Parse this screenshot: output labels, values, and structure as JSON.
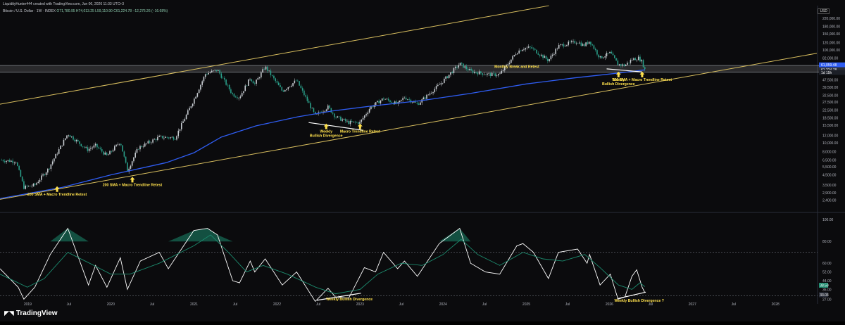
{
  "header": {
    "credit": "LiquidityHunter444 created with TradingView.com, Jun 06, 2026 11:33 UTC+3",
    "symbol": "Bitcoin / U.S. Dollar · 1W · INDEX",
    "ohlc": "O71,780.95 H74,013.25 L59,110.90 C61,224.78 −12,276.26 (−16.68%)"
  },
  "currency_badge": "USD",
  "brand": "TradingView",
  "colors": {
    "up_candle": "#c8cdd2",
    "down_candle": "#2aa08a",
    "sma": "#2f5df2",
    "trendline": "#d9bf5f",
    "annotation": "#ffe14d",
    "rsi": "#ffffff",
    "rsi_ma": "#1c8b6e",
    "background": "#0b0b0d"
  },
  "chart_data": [
    {
      "type": "candlestick",
      "title": "",
      "xlabel": "",
      "ylabel": "",
      "scale": "log",
      "ylim": [
        1900,
        290000
      ],
      "xlim": [
        "2018-09-01",
        "2028-07-01"
      ],
      "y_ticks": [
        "220,000.00",
        "180,000.00",
        "150,000.00",
        "120,000.00",
        "100,000.00",
        "82,000.00",
        "68,000.00",
        "57,500.00",
        "47,500.00",
        "39,500.00",
        "32,500.00",
        "27,500.00",
        "22,500.00",
        "18,500.00",
        "15,500.00",
        "12,000.00",
        "10,000.00",
        "8,000.00",
        "6,500.00",
        "5,500.00",
        "4,500.00",
        "3,500.00",
        "2,900.00",
        "2,400.00"
      ],
      "x_ticks": [
        {
          "date": "2019-01-01",
          "label": "2019"
        },
        {
          "date": "2019-07-01",
          "label": "Jul"
        },
        {
          "date": "2020-01-01",
          "label": "2020"
        },
        {
          "date": "2020-07-01",
          "label": "Jul"
        },
        {
          "date": "2021-01-01",
          "label": "2021"
        },
        {
          "date": "2021-07-01",
          "label": "Jul"
        },
        {
          "date": "2022-01-01",
          "label": "2022"
        },
        {
          "date": "2022-07-01",
          "label": "Jul"
        },
        {
          "date": "2023-01-01",
          "label": "2023"
        },
        {
          "date": "2023-07-01",
          "label": "Jul"
        },
        {
          "date": "2024-01-01",
          "label": "2024"
        },
        {
          "date": "2024-07-01",
          "label": "Jul"
        },
        {
          "date": "2025-01-01",
          "label": "2025"
        },
        {
          "date": "2025-07-01",
          "label": "Jul"
        },
        {
          "date": "2026-01-01",
          "label": "2026"
        },
        {
          "date": "2026-07-01",
          "label": "Jul"
        },
        {
          "date": "2027-01-01",
          "label": "2027"
        },
        {
          "date": "2027-07-01",
          "label": "Jul"
        },
        {
          "date": "2028-01-01",
          "label": "2028"
        }
      ],
      "price_path": [
        [
          "2018-09-01",
          6500
        ],
        [
          "2018-11-10",
          6300
        ],
        [
          "2018-12-15",
          3300
        ],
        [
          "2019-02-01",
          3500
        ],
        [
          "2019-04-01",
          5200
        ],
        [
          "2019-06-26",
          12500
        ],
        [
          "2019-09-20",
          8400
        ],
        [
          "2019-10-26",
          9300
        ],
        [
          "2019-12-15",
          7200
        ],
        [
          "2020-02-12",
          10300
        ],
        [
          "2020-03-14",
          5000
        ],
        [
          "2020-05-01",
          8800
        ],
        [
          "2020-08-01",
          11500
        ],
        [
          "2020-10-10",
          11300
        ],
        [
          "2020-12-31",
          29000
        ],
        [
          "2021-02-20",
          55000
        ],
        [
          "2021-04-14",
          61000
        ],
        [
          "2021-06-20",
          33000
        ],
        [
          "2021-07-20",
          31000
        ],
        [
          "2021-09-05",
          50000
        ],
        [
          "2021-09-25",
          43000
        ],
        [
          "2021-11-10",
          66000
        ],
        [
          "2022-01-24",
          36000
        ],
        [
          "2022-03-28",
          47000
        ],
        [
          "2022-06-18",
          19500
        ],
        [
          "2022-08-13",
          24300
        ],
        [
          "2022-09-15",
          19000
        ],
        [
          "2022-11-12",
          16500
        ],
        [
          "2022-12-31",
          16500
        ],
        [
          "2023-02-15",
          24000
        ],
        [
          "2023-04-14",
          30000
        ],
        [
          "2023-06-15",
          26000
        ],
        [
          "2023-07-15",
          31000
        ],
        [
          "2023-09-10",
          26000
        ],
        [
          "2023-12-15",
          42000
        ],
        [
          "2024-03-14",
          71000
        ],
        [
          "2024-05-01",
          59000
        ],
        [
          "2024-07-05",
          55000
        ],
        [
          "2024-08-05",
          54000
        ],
        [
          "2024-09-06",
          54500
        ],
        [
          "2024-11-20",
          95000
        ],
        [
          "2024-12-17",
          104000
        ],
        [
          "2025-01-20",
          106000
        ],
        [
          "2025-04-08",
          77000
        ],
        [
          "2025-05-22",
          110000
        ],
        [
          "2025-07-14",
          119000
        ],
        [
          "2025-08-14",
          123000
        ],
        [
          "2025-09-10",
          111000
        ],
        [
          "2025-10-06",
          125000
        ],
        [
          "2025-11-21",
          82000
        ],
        [
          "2026-01-05",
          93000
        ],
        [
          "2026-02-08",
          70000
        ],
        [
          "2026-03-10",
          68000
        ],
        [
          "2026-04-10",
          79000
        ],
        [
          "2026-05-10",
          82000
        ],
        [
          "2026-05-25",
          74000
        ],
        [
          "2026-06-06",
          61224.78
        ]
      ],
      "sma_200": [
        [
          "2018-09-01",
          2500
        ],
        [
          "2019-06-01",
          3300
        ],
        [
          "2020-01-01",
          4500
        ],
        [
          "2020-09-01",
          6100
        ],
        [
          "2021-01-01",
          7800
        ],
        [
          "2021-05-01",
          11500
        ],
        [
          "2021-10-01",
          15200
        ],
        [
          "2022-04-01",
          19000
        ],
        [
          "2022-09-01",
          22000
        ],
        [
          "2023-03-01",
          25000
        ],
        [
          "2023-10-01",
          28500
        ],
        [
          "2024-05-01",
          34000
        ],
        [
          "2025-01-01",
          43000
        ],
        [
          "2025-08-01",
          50000
        ],
        [
          "2026-03-01",
          57000
        ],
        [
          "2026-06-06",
          61000
        ]
      ],
      "trendlines": [
        {
          "from": [
            "2018-09-01",
            26000
          ],
          "to": [
            "2025-04-10",
            300000
          ]
        },
        {
          "from": [
            "2018-09-01",
            2450
          ],
          "to": [
            "2028-07-01",
            92000
          ]
        }
      ],
      "resistance_zone": [
        57500,
        68000
      ],
      "price_labels": [
        {
          "value": 69000,
          "text": "61,059.48"
        },
        {
          "value": 61224.78,
          "text": "61,224.78"
        },
        {
          "value": 57200,
          "text": "1d 15h"
        }
      ],
      "annotations": [
        {
          "date": "2019-05-10",
          "value": 2850,
          "text": "200 SMA + Macro Trendline Retest"
        },
        {
          "date": "2020-04-05",
          "value": 3600,
          "text": "200 SMA + Macro Trendline Retest"
        },
        {
          "date": "2022-08-05",
          "value": 13500,
          "text": "Weekly\nBullish Divergence"
        },
        {
          "date": "2023-01-01",
          "value": 13500,
          "text": "Macro Trendline Retest"
        },
        {
          "date": "2024-11-20",
          "value": 64000,
          "text": "Monthly Break and Retest"
        },
        {
          "date": "2026-02-10",
          "value": 49000,
          "text": "Weekly\nBullish Divergence"
        },
        {
          "date": "2026-05-25",
          "value": 49000,
          "text": "200 SMA + Macro Trendline Retest"
        }
      ],
      "divergence_lines": [
        {
          "from": [
            "2022-05-20",
            16500
          ],
          "to": [
            "2023-01-15",
            13600
          ]
        },
        {
          "from": [
            "2025-12-20",
            62500
          ],
          "to": [
            "2026-05-25",
            58000
          ]
        }
      ]
    },
    {
      "type": "line",
      "title": "",
      "ylim": [
        24,
        104
      ],
      "y_ticks": [
        100,
        80,
        60,
        52,
        44,
        36,
        27
      ],
      "levels": [
        70,
        30
      ],
      "series": [
        {
          "role": "rsi",
          "points": [
            [
              "2018-09-01",
              55
            ],
            [
              "2018-11-20",
              38
            ],
            [
              "2018-12-15",
              27
            ],
            [
              "2019-02-01",
              38
            ],
            [
              "2019-04-10",
              68
            ],
            [
              "2019-06-26",
              92
            ],
            [
              "2019-09-25",
              40
            ],
            [
              "2019-10-26",
              58
            ],
            [
              "2019-12-15",
              38
            ],
            [
              "2020-02-12",
              65
            ],
            [
              "2020-03-14",
              36
            ],
            [
              "2020-05-10",
              62
            ],
            [
              "2020-08-01",
              70
            ],
            [
              "2020-09-10",
              55
            ],
            [
              "2020-12-31",
              90
            ],
            [
              "2021-03-01",
              92
            ],
            [
              "2021-04-14",
              86
            ],
            [
              "2021-06-20",
              44
            ],
            [
              "2021-07-20",
              42
            ],
            [
              "2021-09-05",
              62
            ],
            [
              "2021-09-25",
              52
            ],
            [
              "2021-11-10",
              64
            ],
            [
              "2022-01-24",
              40
            ],
            [
              "2022-03-28",
              52
            ],
            [
              "2022-06-18",
              25
            ],
            [
              "2022-08-13",
              37
            ],
            [
              "2022-09-15",
              29
            ],
            [
              "2022-11-12",
              28
            ],
            [
              "2023-01-20",
              56
            ],
            [
              "2023-03-10",
              52
            ],
            [
              "2023-04-14",
              70
            ],
            [
              "2023-06-15",
              55
            ],
            [
              "2023-07-15",
              62
            ],
            [
              "2023-09-10",
              48
            ],
            [
              "2023-12-15",
              78
            ],
            [
              "2024-03-14",
              92
            ],
            [
              "2024-05-01",
              60
            ],
            [
              "2024-07-05",
              52
            ],
            [
              "2024-09-06",
              50
            ],
            [
              "2024-11-20",
              76
            ],
            [
              "2024-12-17",
              78
            ],
            [
              "2025-02-01",
              70
            ],
            [
              "2025-04-08",
              46
            ],
            [
              "2025-05-22",
              70
            ],
            [
              "2025-08-14",
              73
            ],
            [
              "2025-09-25",
              60
            ],
            [
              "2025-10-06",
              68
            ],
            [
              "2025-11-21",
              40
            ],
            [
              "2026-01-05",
              50
            ],
            [
              "2026-02-08",
              27
            ],
            [
              "2026-03-10",
              29
            ],
            [
              "2026-04-10",
              48
            ],
            [
              "2026-05-01",
              54
            ],
            [
              "2026-05-25",
              38
            ],
            [
              "2026-06-06",
              33.03
            ]
          ]
        },
        {
          "role": "rsi_ma",
          "points": [
            [
              "2018-09-01",
              50
            ],
            [
              "2018-12-30",
              38
            ],
            [
              "2019-03-15",
              46
            ],
            [
              "2019-06-26",
              70
            ],
            [
              "2019-09-30",
              60
            ],
            [
              "2020-01-01",
              50
            ],
            [
              "2020-03-25",
              50
            ],
            [
              "2020-08-01",
              60
            ],
            [
              "2020-12-31",
              76
            ],
            [
              "2021-03-15",
              86
            ],
            [
              "2021-06-01",
              70
            ],
            [
              "2021-08-20",
              52
            ],
            [
              "2021-11-01",
              58
            ],
            [
              "2022-02-15",
              50
            ],
            [
              "2022-06-20",
              38
            ],
            [
              "2022-09-15",
              32
            ],
            [
              "2023-01-01",
              36
            ],
            [
              "2023-03-20",
              50
            ],
            [
              "2023-07-01",
              60
            ],
            [
              "2023-10-01",
              58
            ],
            [
              "2024-01-01",
              68
            ],
            [
              "2024-03-20",
              82
            ],
            [
              "2024-06-01",
              68
            ],
            [
              "2024-09-06",
              58
            ],
            [
              "2024-12-17",
              70
            ],
            [
              "2025-03-15",
              64
            ],
            [
              "2025-06-10",
              62
            ],
            [
              "2025-09-15",
              68
            ],
            [
              "2025-11-21",
              56
            ],
            [
              "2026-02-10",
              40
            ],
            [
              "2026-04-10",
              36
            ],
            [
              "2026-05-15",
              42
            ],
            [
              "2026-06-06",
              38.5
            ]
          ]
        }
      ],
      "value_labels": [
        {
          "value": 38.5,
          "text": "38.59"
        },
        {
          "value": 33.03,
          "text": "33.03"
        }
      ],
      "annotations": [
        {
          "date": "2022-11-15",
          "value": 26,
          "text": "Weekly Bullish Divergence"
        },
        {
          "date": "2026-05-12",
          "value": 24.6,
          "text": "Weekly Bullish Divergence ?"
        }
      ],
      "divergence_lines": [
        {
          "from": [
            "2022-06-25",
            26
          ],
          "to": [
            "2023-01-05",
            32.5
          ]
        },
        {
          "from": [
            "2026-02-05",
            27.5
          ],
          "to": [
            "2026-06-10",
            33.5
          ]
        }
      ]
    }
  ]
}
